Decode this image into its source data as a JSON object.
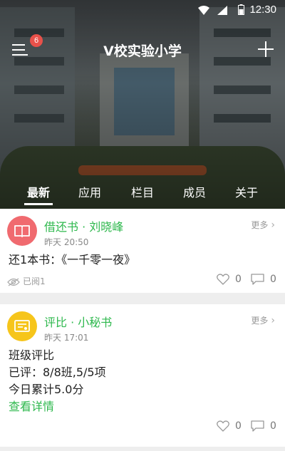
{
  "status_bar": {
    "time": "12:30"
  },
  "header": {
    "title": "V校实验小学",
    "menu_badge": "6"
  },
  "tabs": [
    {
      "label": "最新",
      "selected": true
    },
    {
      "label": "应用"
    },
    {
      "label": "栏目"
    },
    {
      "label": "成员"
    },
    {
      "label": "关于"
    }
  ],
  "feed": [
    {
      "avatar_icon": "book-icon",
      "avatar_color": "#f06a6f",
      "title": "借还书 · 刘晓峰",
      "time": "昨天 20:50",
      "more_label": "更多",
      "lines": [
        "还1本书：《一千零一夜》"
      ],
      "read_label": "已阅1",
      "likes": "0",
      "comments": "0"
    },
    {
      "avatar_icon": "certificate-icon",
      "avatar_color": "#f6c51b",
      "title": "评比 · 小秘书",
      "time": "昨天 17:01",
      "more_label": "更多",
      "lines": [
        "班级评比",
        "已评：8/8班,5/5项",
        "今日累计5.0分"
      ],
      "link": "查看详情",
      "likes": "0",
      "comments": "0"
    }
  ],
  "colors": {
    "accent_green": "#2eb84d",
    "badge_red": "#e8514a"
  }
}
